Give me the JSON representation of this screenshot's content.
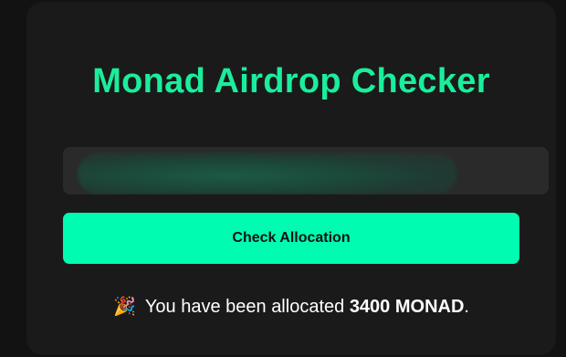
{
  "page": {
    "title": "Monad Airdrop Checker"
  },
  "form": {
    "address_value": "",
    "button_label": "Check Allocation"
  },
  "result": {
    "emoji": "🎉",
    "prefix": "You have been allocated",
    "amount": "3400 MONAD",
    "suffix": "."
  },
  "colors": {
    "background": "#121212",
    "card": "#1a1a1a",
    "accent_title": "#1aee9c",
    "button": "#00fcb0",
    "input": "#2a2a2a"
  }
}
